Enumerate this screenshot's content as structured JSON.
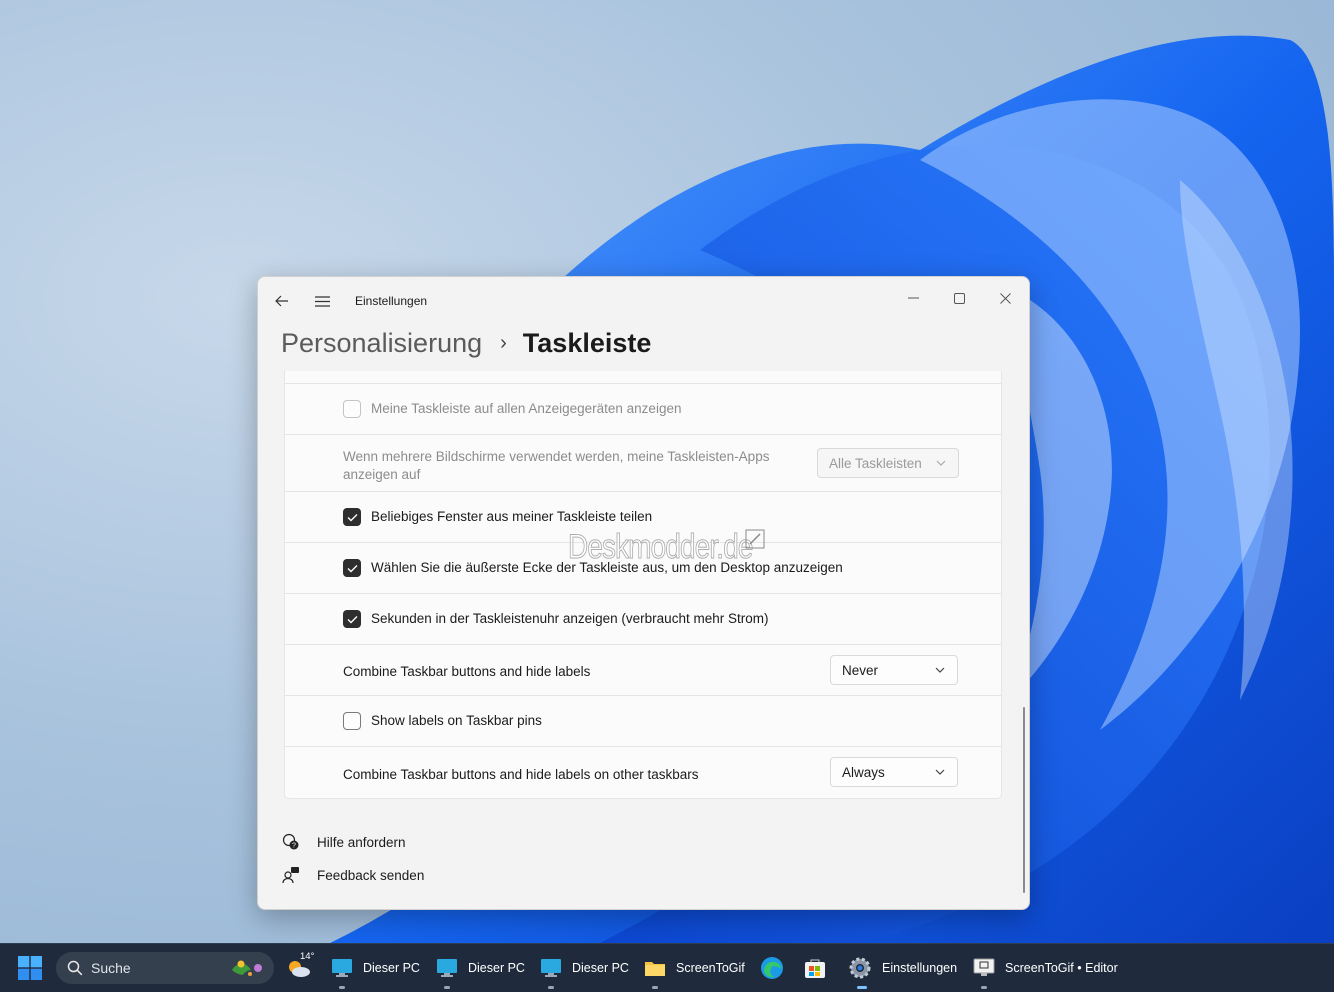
{
  "window": {
    "app_title": "Einstellungen",
    "breadcrumb": {
      "parent": "Personalisierung",
      "separator": "›",
      "current": "Taskleiste"
    }
  },
  "settings": {
    "show_on_all_displays": {
      "label": "Meine Taskleiste auf allen Anzeigegeräten anzeigen",
      "checked": false,
      "disabled": true
    },
    "multi_monitor_apps": {
      "label": "Wenn mehrere Bildschirme verwendet werden, meine Taskleisten-Apps anzeigen auf",
      "value": "Alle Taskleisten",
      "disabled": true
    },
    "share_window": {
      "label": "Beliebiges Fenster aus meiner Taskleiste teilen",
      "checked": true
    },
    "far_corner_desktop": {
      "label": "Wählen Sie die äußerste Ecke der Taskleiste aus, um den Desktop anzuzeigen",
      "checked": true
    },
    "seconds_clock": {
      "label": "Sekunden in der Taskleistenuhr anzeigen (verbraucht mehr Strom)",
      "checked": true
    },
    "combine_buttons": {
      "label": "Combine Taskbar buttons and hide labels",
      "value": "Never"
    },
    "show_labels_pins": {
      "label": "Show labels on Taskbar pins",
      "checked": false
    },
    "combine_other": {
      "label": "Combine Taskbar buttons and hide labels on other taskbars",
      "value": "Always"
    }
  },
  "links": {
    "help": "Hilfe anfordern",
    "feedback": "Feedback senden"
  },
  "watermark": "Deskmodder.de",
  "taskbar": {
    "search_placeholder": "Suche",
    "weather_temp": "14°",
    "items": [
      {
        "label": "Dieser PC"
      },
      {
        "label": "Dieser PC"
      },
      {
        "label": "Dieser PC"
      },
      {
        "label": "ScreenToGif"
      },
      {
        "label": "Einstellungen"
      },
      {
        "label": "ScreenToGif • Editor"
      }
    ]
  },
  "colors": {
    "accent": "#0067c0",
    "checkbox_on": "#2e2e2e",
    "taskbar": "#1f2b3d"
  }
}
